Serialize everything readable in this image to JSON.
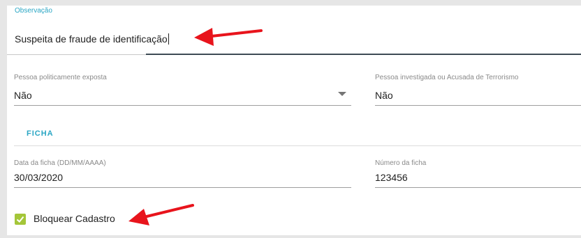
{
  "observacao": {
    "label": "Observação",
    "value": "Suspeita de fraude de identificação"
  },
  "pep": {
    "label": "Pessoa politicamente exposta",
    "value": "Não"
  },
  "terrorismo": {
    "label": "Pessoa investigada ou Acusada de Terrorismo",
    "value": "Não"
  },
  "ficha": {
    "section_title": "FICHA",
    "data_label": "Data da ficha (DD/MM/AAAA)",
    "data_value": "30/03/2020",
    "numero_label": "Número da ficha",
    "numero_value": "123456"
  },
  "bloquear": {
    "label": "Bloquear Cadastro",
    "checked": true
  },
  "colors": {
    "accent": "#2aa6c4",
    "checkbox": "#a4c639",
    "annotation_arrow": "#e8141c"
  }
}
